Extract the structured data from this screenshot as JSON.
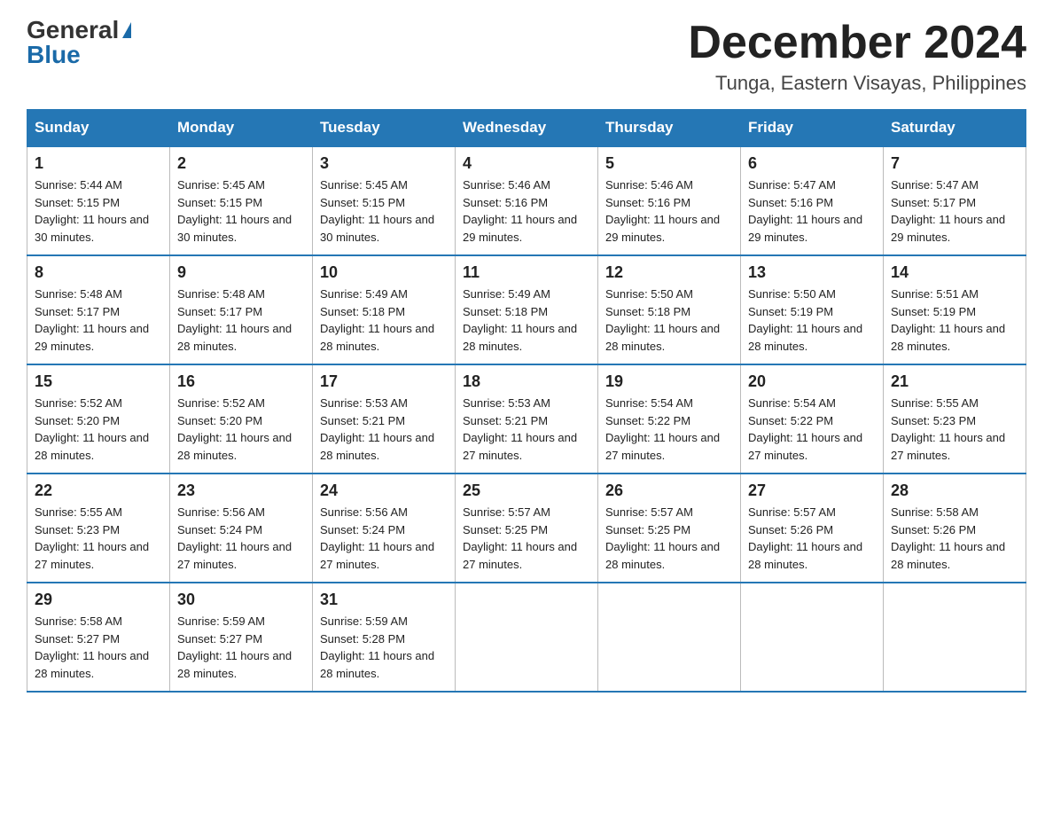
{
  "logo": {
    "general": "General",
    "blue": "Blue"
  },
  "title": {
    "month": "December 2024",
    "location": "Tunga, Eastern Visayas, Philippines"
  },
  "header_days": [
    "Sunday",
    "Monday",
    "Tuesday",
    "Wednesday",
    "Thursday",
    "Friday",
    "Saturday"
  ],
  "weeks": [
    [
      {
        "day": "1",
        "sunrise": "5:44 AM",
        "sunset": "5:15 PM",
        "daylight": "11 hours and 30 minutes."
      },
      {
        "day": "2",
        "sunrise": "5:45 AM",
        "sunset": "5:15 PM",
        "daylight": "11 hours and 30 minutes."
      },
      {
        "day": "3",
        "sunrise": "5:45 AM",
        "sunset": "5:15 PM",
        "daylight": "11 hours and 30 minutes."
      },
      {
        "day": "4",
        "sunrise": "5:46 AM",
        "sunset": "5:16 PM",
        "daylight": "11 hours and 29 minutes."
      },
      {
        "day": "5",
        "sunrise": "5:46 AM",
        "sunset": "5:16 PM",
        "daylight": "11 hours and 29 minutes."
      },
      {
        "day": "6",
        "sunrise": "5:47 AM",
        "sunset": "5:16 PM",
        "daylight": "11 hours and 29 minutes."
      },
      {
        "day": "7",
        "sunrise": "5:47 AM",
        "sunset": "5:17 PM",
        "daylight": "11 hours and 29 minutes."
      }
    ],
    [
      {
        "day": "8",
        "sunrise": "5:48 AM",
        "sunset": "5:17 PM",
        "daylight": "11 hours and 29 minutes."
      },
      {
        "day": "9",
        "sunrise": "5:48 AM",
        "sunset": "5:17 PM",
        "daylight": "11 hours and 28 minutes."
      },
      {
        "day": "10",
        "sunrise": "5:49 AM",
        "sunset": "5:18 PM",
        "daylight": "11 hours and 28 minutes."
      },
      {
        "day": "11",
        "sunrise": "5:49 AM",
        "sunset": "5:18 PM",
        "daylight": "11 hours and 28 minutes."
      },
      {
        "day": "12",
        "sunrise": "5:50 AM",
        "sunset": "5:18 PM",
        "daylight": "11 hours and 28 minutes."
      },
      {
        "day": "13",
        "sunrise": "5:50 AM",
        "sunset": "5:19 PM",
        "daylight": "11 hours and 28 minutes."
      },
      {
        "day": "14",
        "sunrise": "5:51 AM",
        "sunset": "5:19 PM",
        "daylight": "11 hours and 28 minutes."
      }
    ],
    [
      {
        "day": "15",
        "sunrise": "5:52 AM",
        "sunset": "5:20 PM",
        "daylight": "11 hours and 28 minutes."
      },
      {
        "day": "16",
        "sunrise": "5:52 AM",
        "sunset": "5:20 PM",
        "daylight": "11 hours and 28 minutes."
      },
      {
        "day": "17",
        "sunrise": "5:53 AM",
        "sunset": "5:21 PM",
        "daylight": "11 hours and 28 minutes."
      },
      {
        "day": "18",
        "sunrise": "5:53 AM",
        "sunset": "5:21 PM",
        "daylight": "11 hours and 27 minutes."
      },
      {
        "day": "19",
        "sunrise": "5:54 AM",
        "sunset": "5:22 PM",
        "daylight": "11 hours and 27 minutes."
      },
      {
        "day": "20",
        "sunrise": "5:54 AM",
        "sunset": "5:22 PM",
        "daylight": "11 hours and 27 minutes."
      },
      {
        "day": "21",
        "sunrise": "5:55 AM",
        "sunset": "5:23 PM",
        "daylight": "11 hours and 27 minutes."
      }
    ],
    [
      {
        "day": "22",
        "sunrise": "5:55 AM",
        "sunset": "5:23 PM",
        "daylight": "11 hours and 27 minutes."
      },
      {
        "day": "23",
        "sunrise": "5:56 AM",
        "sunset": "5:24 PM",
        "daylight": "11 hours and 27 minutes."
      },
      {
        "day": "24",
        "sunrise": "5:56 AM",
        "sunset": "5:24 PM",
        "daylight": "11 hours and 27 minutes."
      },
      {
        "day": "25",
        "sunrise": "5:57 AM",
        "sunset": "5:25 PM",
        "daylight": "11 hours and 27 minutes."
      },
      {
        "day": "26",
        "sunrise": "5:57 AM",
        "sunset": "5:25 PM",
        "daylight": "11 hours and 28 minutes."
      },
      {
        "day": "27",
        "sunrise": "5:57 AM",
        "sunset": "5:26 PM",
        "daylight": "11 hours and 28 minutes."
      },
      {
        "day": "28",
        "sunrise": "5:58 AM",
        "sunset": "5:26 PM",
        "daylight": "11 hours and 28 minutes."
      }
    ],
    [
      {
        "day": "29",
        "sunrise": "5:58 AM",
        "sunset": "5:27 PM",
        "daylight": "11 hours and 28 minutes."
      },
      {
        "day": "30",
        "sunrise": "5:59 AM",
        "sunset": "5:27 PM",
        "daylight": "11 hours and 28 minutes."
      },
      {
        "day": "31",
        "sunrise": "5:59 AM",
        "sunset": "5:28 PM",
        "daylight": "11 hours and 28 minutes."
      },
      null,
      null,
      null,
      null
    ]
  ]
}
